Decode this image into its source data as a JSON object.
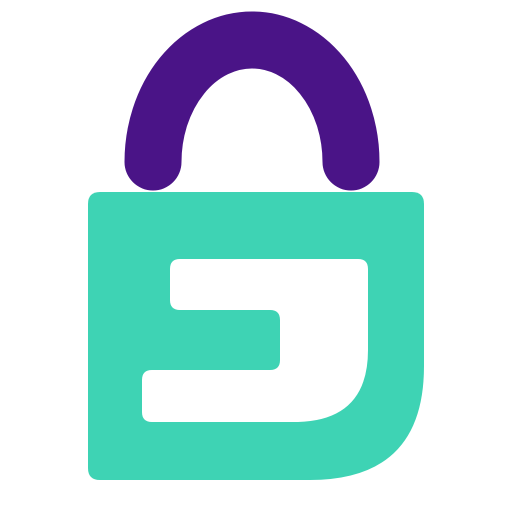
{
  "logo": {
    "icon": "padlock-logo-icon",
    "colors": {
      "background": "#ffffff",
      "shackle": "#4a1487",
      "body": "#3ed3b4",
      "glyph": "#ffffff"
    }
  }
}
